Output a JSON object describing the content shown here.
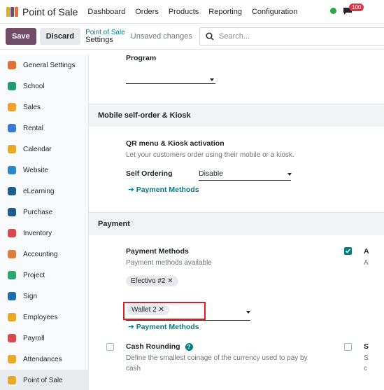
{
  "topnav": {
    "app_name": "Point of Sale",
    "menu": [
      "Dashboard",
      "Orders",
      "Products",
      "Reporting",
      "Configuration"
    ],
    "badge": "100"
  },
  "control": {
    "save_label": "Save",
    "discard_label": "Discard",
    "breadcrumb_parent": "Point of Sale",
    "breadcrumb_current": "Settings",
    "unsaved": "Unsaved changes",
    "search_placeholder": "Search..."
  },
  "sidebar": {
    "items": [
      {
        "label": "General Settings",
        "icon": "gear-icon",
        "color": "#e46f33"
      },
      {
        "label": "School",
        "icon": "school-icon",
        "color": "#1f9b6e"
      },
      {
        "label": "Sales",
        "icon": "sales-icon",
        "color": "#f0a02b"
      },
      {
        "label": "Rental",
        "icon": "rental-icon",
        "color": "#3a7bd5"
      },
      {
        "label": "Calendar",
        "icon": "calendar-icon",
        "color": "#e9a825"
      },
      {
        "label": "Website",
        "icon": "website-icon",
        "color": "#2b87c8"
      },
      {
        "label": "eLearning",
        "icon": "elearning-icon",
        "color": "#1a5f8e"
      },
      {
        "label": "Purchase",
        "icon": "purchase-icon",
        "color": "#1d5c8c"
      },
      {
        "label": "Inventory",
        "icon": "inventory-icon",
        "color": "#d9484b"
      },
      {
        "label": "Accounting",
        "icon": "accounting-icon",
        "color": "#e07b39"
      },
      {
        "label": "Project",
        "icon": "project-icon",
        "color": "#2ea76e"
      },
      {
        "label": "Sign",
        "icon": "sign-icon",
        "color": "#1b6fa8"
      },
      {
        "label": "Employees",
        "icon": "employees-icon",
        "color": "#e9a825"
      },
      {
        "label": "Payroll",
        "icon": "payroll-icon",
        "color": "#d9484b"
      },
      {
        "label": "Attendances",
        "icon": "attendances-icon",
        "color": "#e9a825"
      },
      {
        "label": "Point of Sale",
        "icon": "point-of-sale-icon",
        "color": "#e9a825"
      }
    ]
  },
  "main": {
    "program_label": "Program",
    "section_kiosk": "Mobile self-order & Kiosk",
    "qr_title": "QR menu & Kiosk activation",
    "qr_desc": "Let your customers order using their mobile or a kiosk.",
    "self_ordering_label": "Self Ordering",
    "self_ordering_value": "Disable",
    "payment_methods_link_1": "➔ Payment Methods",
    "section_payment": "Payment",
    "pm_title": "Payment Methods",
    "pm_desc": "Payment methods available",
    "tag_efectivo": "Efectivo #2",
    "tag_wallet": "Wallet 2",
    "payment_methods_link_2": "➔ Payment Methods",
    "cash_rounding_title": "Cash Rounding",
    "cash_rounding_desc": "Define the smallest coinage of the currency used to pay by",
    "cash_rounding_desc2": "cash",
    "right_col_a": "A",
    "right_col_a2": "A",
    "right_col_s": "S",
    "right_col_s2": "S",
    "right_col_c": "c"
  }
}
